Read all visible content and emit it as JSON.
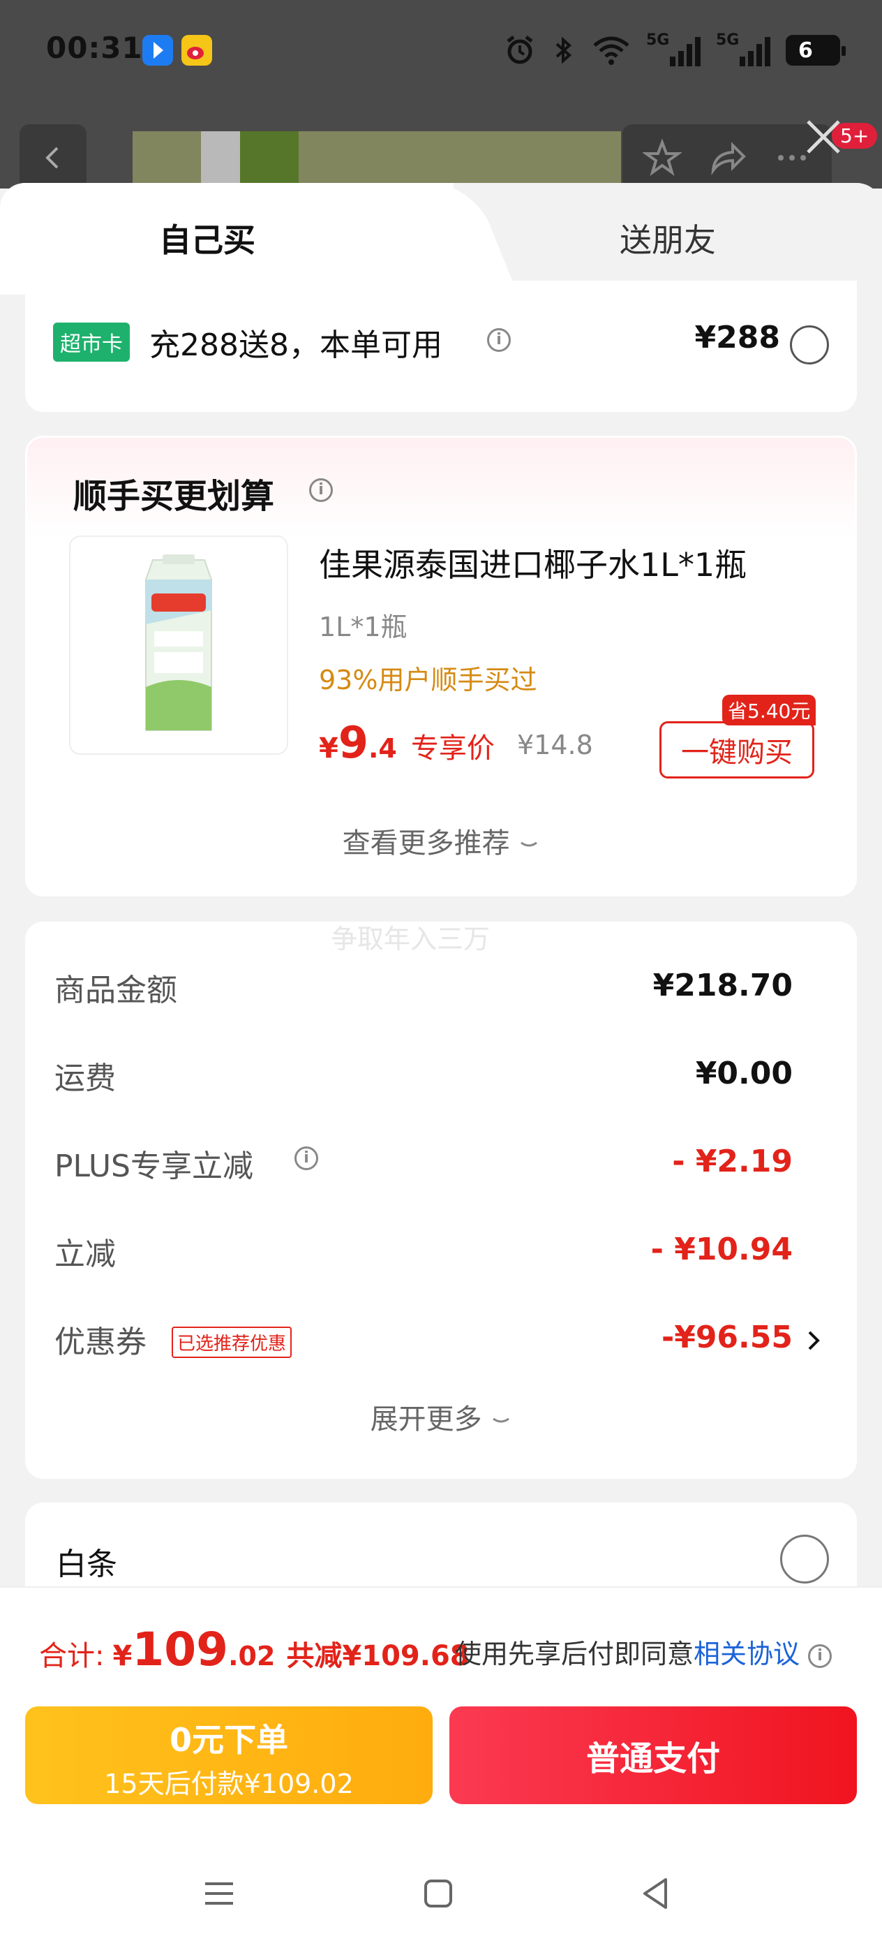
{
  "status_bar": {
    "time": "00:31",
    "signal1_tag": "5G",
    "signal2_tag": "5G",
    "battery": "6"
  },
  "background_page": {
    "badge": "5+"
  },
  "tabs": {
    "self": "自己买",
    "gift": "送朋友"
  },
  "supermarket_card": {
    "chip": "超市卡",
    "promo": "充288送8，本单可用",
    "price": "¥288"
  },
  "recommend": {
    "heading": "顺手买更划算",
    "product": {
      "title": "佳果源泰国进口椰子水1L*1瓶",
      "spec": "1L*1瓶",
      "bought": "93%用户顺手买过",
      "price_currency": "¥",
      "price_int": "9",
      "price_dec": ".4",
      "price_label": "专享价",
      "original_price": "¥14.8",
      "save_tag": "省5.40元",
      "buy_button": "一键购买"
    },
    "more": "查看更多推荐"
  },
  "summary": {
    "ghost_text": "争取年入三万",
    "rows": [
      {
        "label": "商品金额",
        "value": "¥218.70"
      },
      {
        "label": "运费",
        "value": "¥0.00"
      },
      {
        "label": "PLUS专享立减",
        "value": "- ¥2.19"
      },
      {
        "label": "立减",
        "value": "- ¥10.94"
      },
      {
        "label": "优惠券",
        "value": "-¥96.55",
        "chip": "已选推荐优惠"
      }
    ],
    "expand": "展开更多"
  },
  "payment": {
    "label": "白条"
  },
  "footer": {
    "total_label": "合计:",
    "total_currency": "¥",
    "total_int": "109",
    "total_dec": ".02",
    "total_saving": "共减¥109.68",
    "agree_prefix": "使用先享后付即同意",
    "agree_link": "相关协议",
    "btn_zero_line1": "0元下单",
    "btn_zero_line2": "15天后付款¥109.02",
    "btn_pay": "普通支付"
  },
  "colors": {
    "accent_red": "#e2231a",
    "green_chip": "#1eb16d",
    "orange": "#d68a13",
    "link": "#1b63d8"
  }
}
